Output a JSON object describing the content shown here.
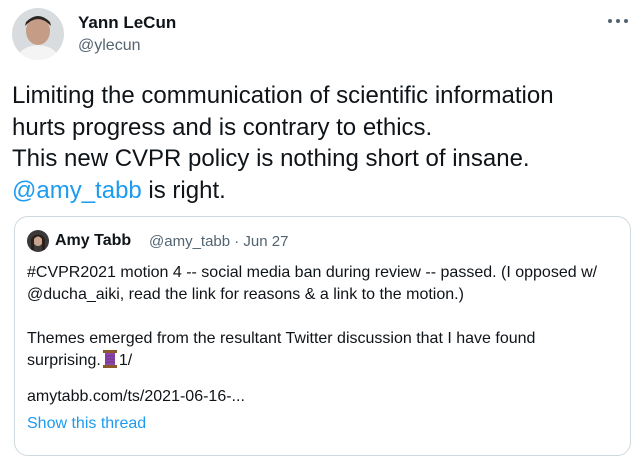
{
  "author": {
    "name": "Yann LeCun",
    "handle": "@ylecun"
  },
  "menu": {
    "icon": "more-icon"
  },
  "tweet": {
    "line1": "Limiting the communication of scientific information",
    "line2": "hurts progress and is contrary to ethics.",
    "line3": "This new CVPR policy is nothing short of insane.",
    "mention": "@amy_tabb",
    "line4_rest": " is right."
  },
  "quote": {
    "name": "Amy Tabb",
    "handle_date": "@amy_tabb · Jun 27",
    "para1_line1": "#CVPR2021 motion 4 -- social media ban during review -- passed. (I opposed w/",
    "para1_mention": "@ducha_aiki",
    "para1_rest": ", read the link for reasons & a link to the motion.)",
    "para2_line1": "Themes emerged from the resultant Twitter discussion that I have found",
    "para2_start": "surprising.",
    "thread_emoji": "thread-spool-icon",
    "para2_end": "1/",
    "link": "amytabb.com/ts/2021-06-16-...",
    "show_thread": "Show this thread"
  },
  "colors": {
    "text": "#0f1419",
    "secondary": "#536471",
    "link": "#1d9bf0",
    "border": "#cfd9de"
  }
}
